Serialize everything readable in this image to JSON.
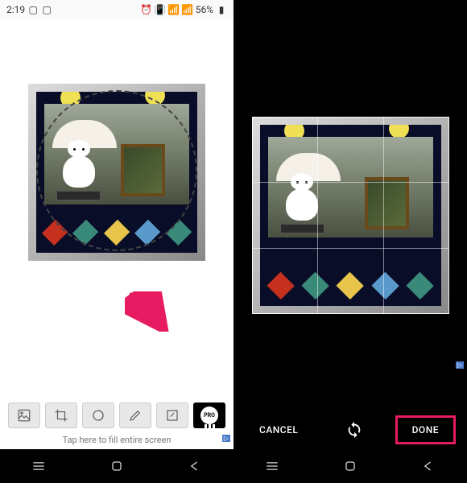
{
  "status": {
    "time": "2:19",
    "battery": "56%"
  },
  "left": {
    "hint": "Tap here to fill entire screen",
    "pro_label": "PRO",
    "ad_label": "▷"
  },
  "right": {
    "cancel": "CANCEL",
    "done": "DONE",
    "ad_label": "▷"
  },
  "annotation": {
    "arrow_color": "#e61b62",
    "highlight_color": "#e61b62"
  }
}
